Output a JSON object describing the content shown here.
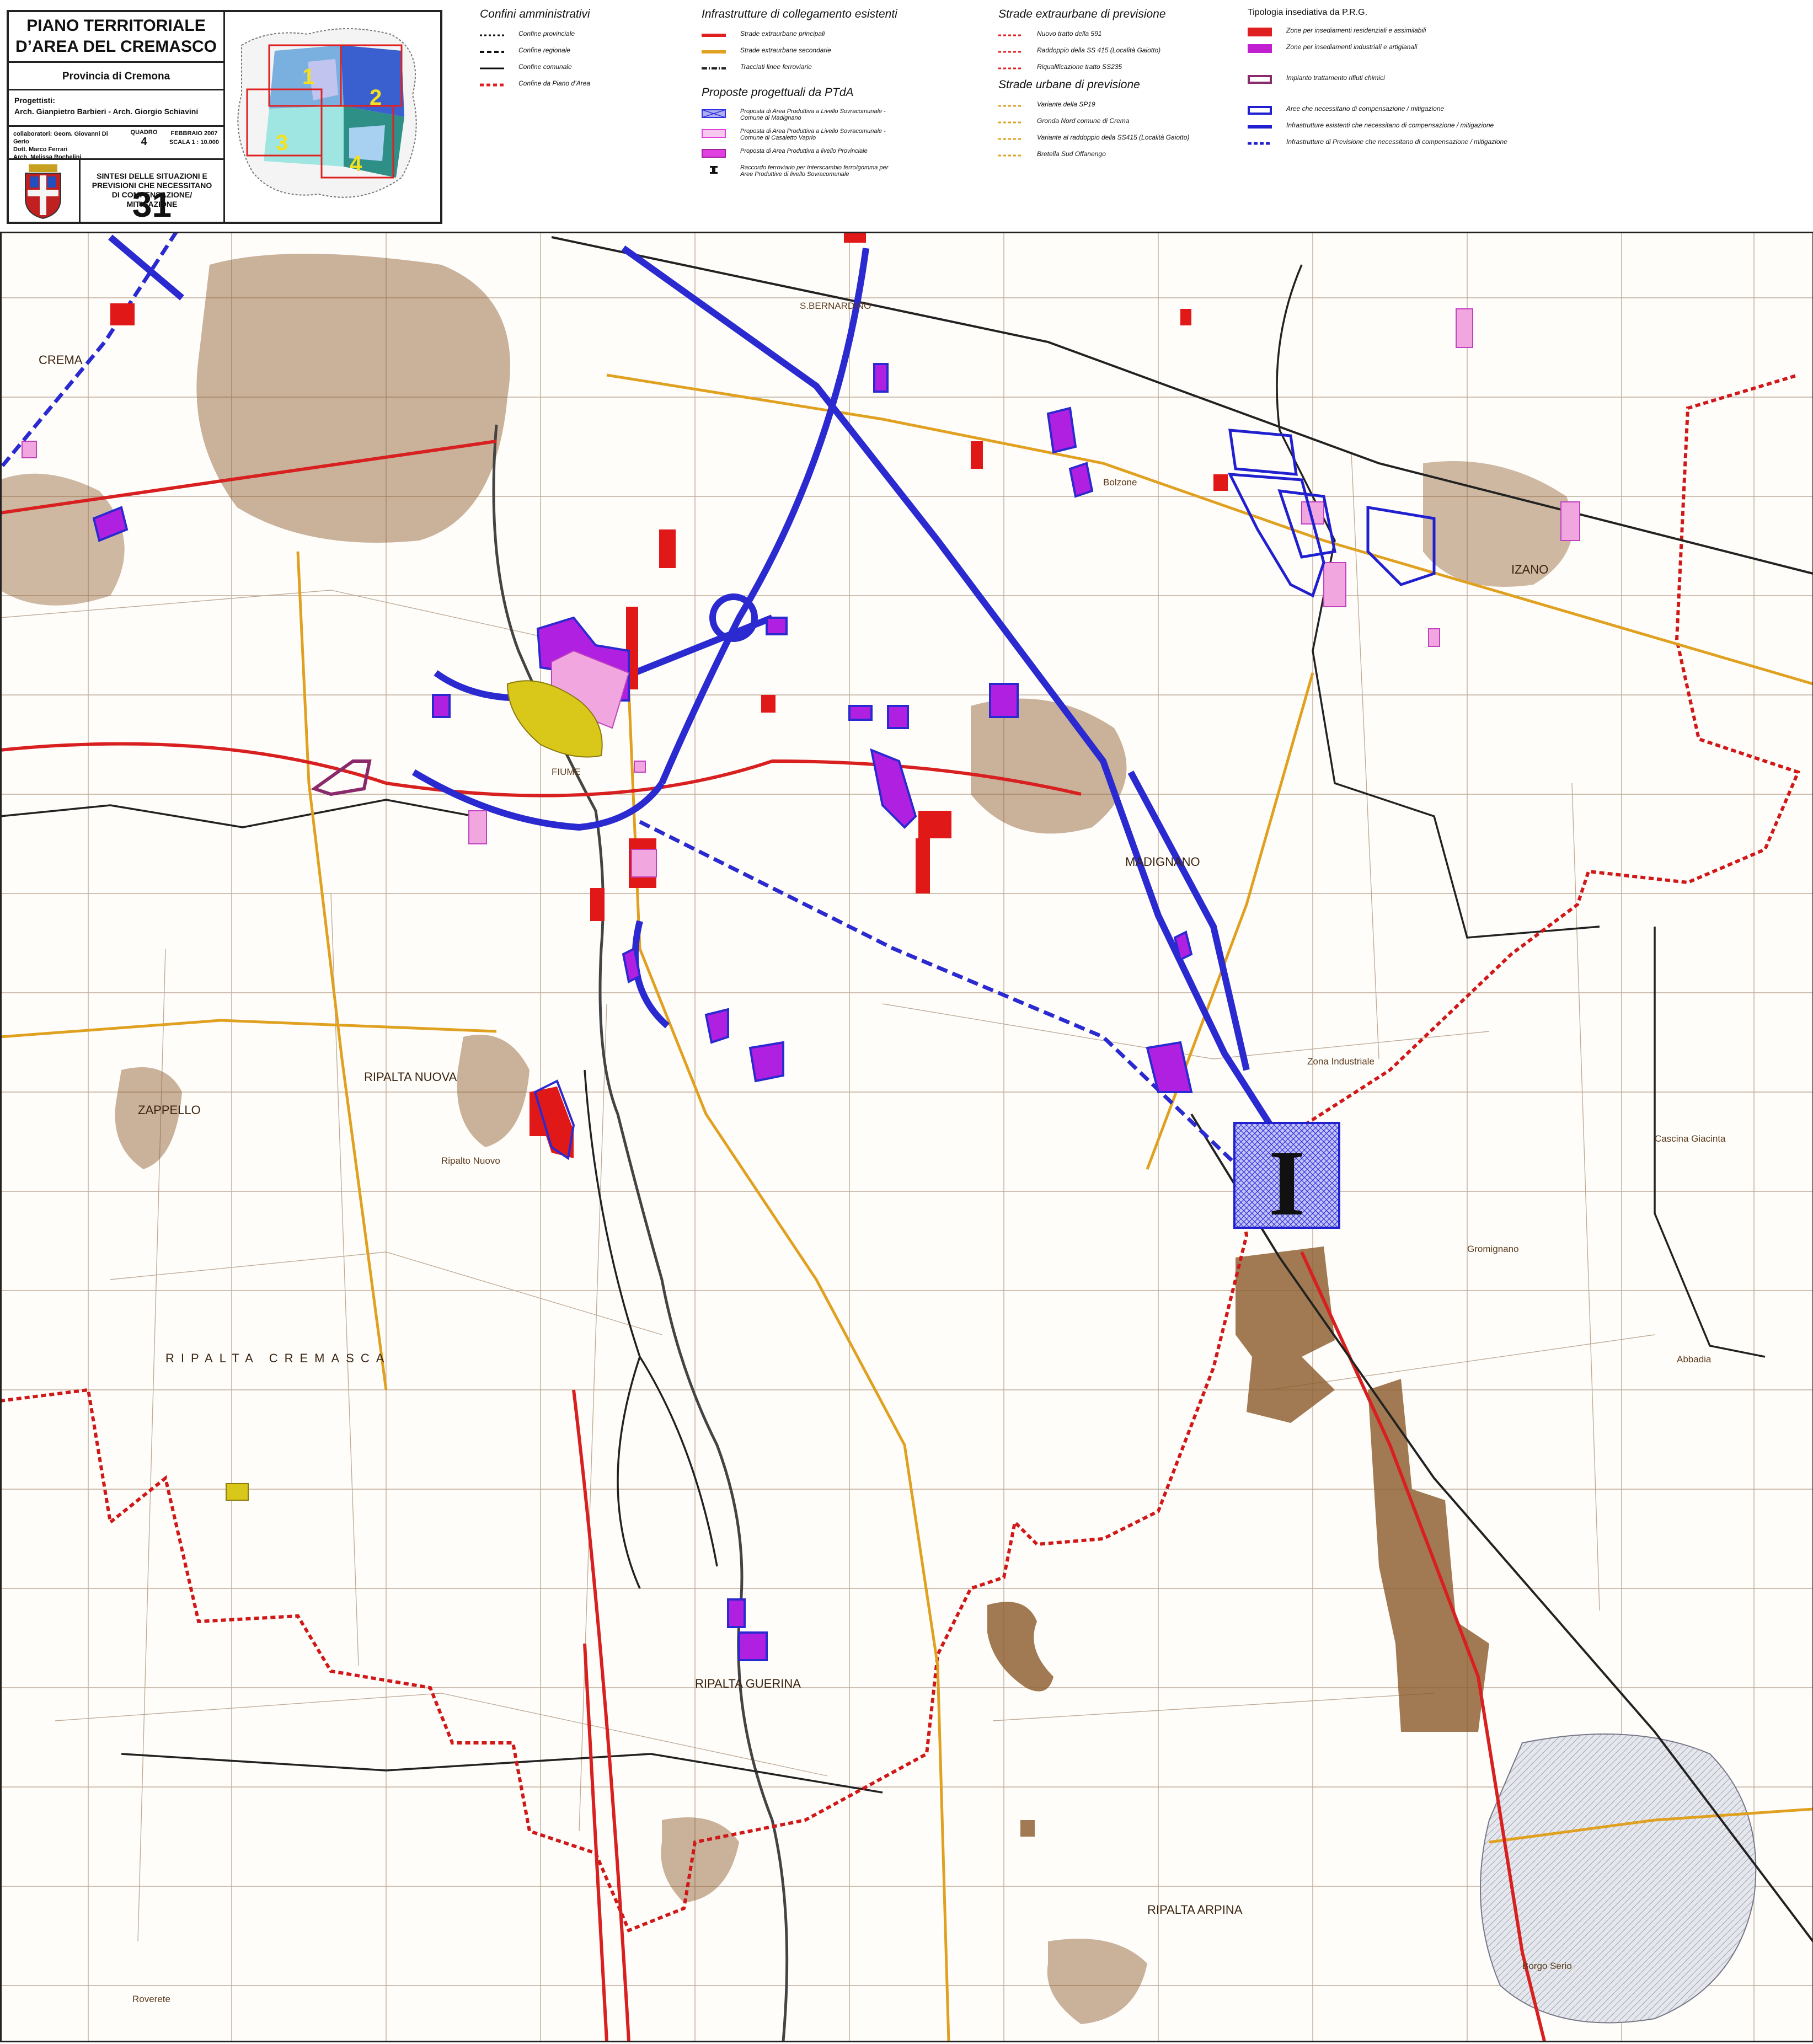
{
  "title_block": {
    "title": "PIANO TERRITORIALE\nD’AREA DEL CREMASCO",
    "province": "Provincia di Cremona",
    "designers": "Progettisti:\nArch. Gianpietro Barbieri - Arch. Giorgio Schiavini",
    "collaborators": "collaboratori: Geom. Giovanni Di Gerio\nDott. Marco Ferrari\nArch. Melissa Rochelini",
    "sheet_label": "QUADRO",
    "sheet_number": "4",
    "date": "FEBBRAIO 2007",
    "scale": "SCALA 1 : 10.000",
    "subject": "SINTESI DELLE SITUAZIONI E\nPREVISIONI CHE NECESSITANO\nDI COMPENSAZIONE/\nMITIGAZIONE",
    "table_number": "31",
    "key_map_labels": [
      "1",
      "2",
      "3",
      "4"
    ]
  },
  "legend": {
    "confini": {
      "heading": "Confini amministrativi",
      "items": [
        {
          "label": "Confine provinciale",
          "style": "dash-short-black"
        },
        {
          "label": "Confine regionale",
          "style": "dash-long-black"
        },
        {
          "label": "Confine comunale",
          "style": "solid-black"
        },
        {
          "label": "Confine da Piano d’Area",
          "style": "dash-red"
        }
      ]
    },
    "infrastrutture": {
      "heading": "Infrastrutture di collegamento esistenti",
      "items": [
        {
          "label": "Strade extraurbane principali",
          "color": "#e02020"
        },
        {
          "label": "Strade extraurbane secondarie",
          "color": "#e0a020"
        },
        {
          "label": "Tracciati linee ferroviarie",
          "color": "#222222"
        }
      ]
    },
    "proposte": {
      "heading": "Proposte progettuali da PTdA",
      "items": [
        {
          "label": "Proposta di Area Produttiva a Livello Sovracomunale - Comune di Madignano",
          "color": "#3030e0"
        },
        {
          "label": "Proposta di Area Produttiva a Livello Sovracomunale - Comune di Casaletto Vaprio",
          "color": "#f0a0e0"
        },
        {
          "label": "Proposta di Area Produttiva a livello Provinciale",
          "color": "#e040e0"
        },
        {
          "label": "Raccordo ferroviario per Interscambio ferro/gomma per Aree Produttive di livello Sovracomunale",
          "color": "#111111"
        }
      ]
    },
    "strade_extraurbane": {
      "heading": "Strade extraurbane di previsione",
      "items": [
        {
          "label": "Nuovo tratto della 591",
          "color": "#e02020"
        },
        {
          "label": "Raddoppio della SS 415  (Località Gaiotto)",
          "color": "#e02020"
        },
        {
          "label": "Riqualificazione tratto SS235",
          "color": "#e02020"
        }
      ]
    },
    "strade_urbane": {
      "heading": "Strade urbane di previsione",
      "items": [
        {
          "label": "Variante della SP19",
          "color": "#e0a020"
        },
        {
          "label": "Gronda Nord comune di Crema",
          "color": "#e0a020"
        },
        {
          "label": "Variante al raddoppio della SS415  (Località Gaiotto)",
          "color": "#e0a020"
        },
        {
          "label": "Bretella Sud Offanengo",
          "color": "#e0a020"
        }
      ]
    },
    "tipologia": {
      "heading": "Tipologia insediativa da P.R.G.",
      "items": [
        {
          "label": "Zone per insediamenti residenziali e assimilabili",
          "color": "#e02020"
        },
        {
          "label": "Zone per insediamenti industriali e artigianali",
          "color": "#c020d0"
        },
        {
          "label": "Impianto trattamento rifiuti chimici",
          "color": "#8a2a6a"
        },
        {
          "label": "Aree che necessitano di compensazione / mitigazione",
          "color": "#2020d0"
        },
        {
          "label": "Infrastrutture esistenti che necessitano di compensazione / mitigazione",
          "color": "#2020d0"
        },
        {
          "label": "Infrastrutture di Previsione che necessitano di compensazione / mitigazione",
          "color": "#2020d0"
        }
      ]
    }
  },
  "map": {
    "places": [
      "CREMA",
      "S.BERNARDINO",
      "IZANO",
      "MADIGNANO",
      "RIPALTA NUOVA",
      "ZAPPELLO",
      "RIPALTA CREMASCA",
      "RIPALTA GUERINA",
      "RIPALTA ARPINA",
      "Bolzone",
      "Ripalto Nuovo",
      "FIUME",
      "Cascina Giacinta",
      "Gromignano",
      "Abbadia",
      "Roverete",
      "Zona Industriale",
      "Borgo Serio"
    ],
    "intermodal_marker": "I"
  }
}
